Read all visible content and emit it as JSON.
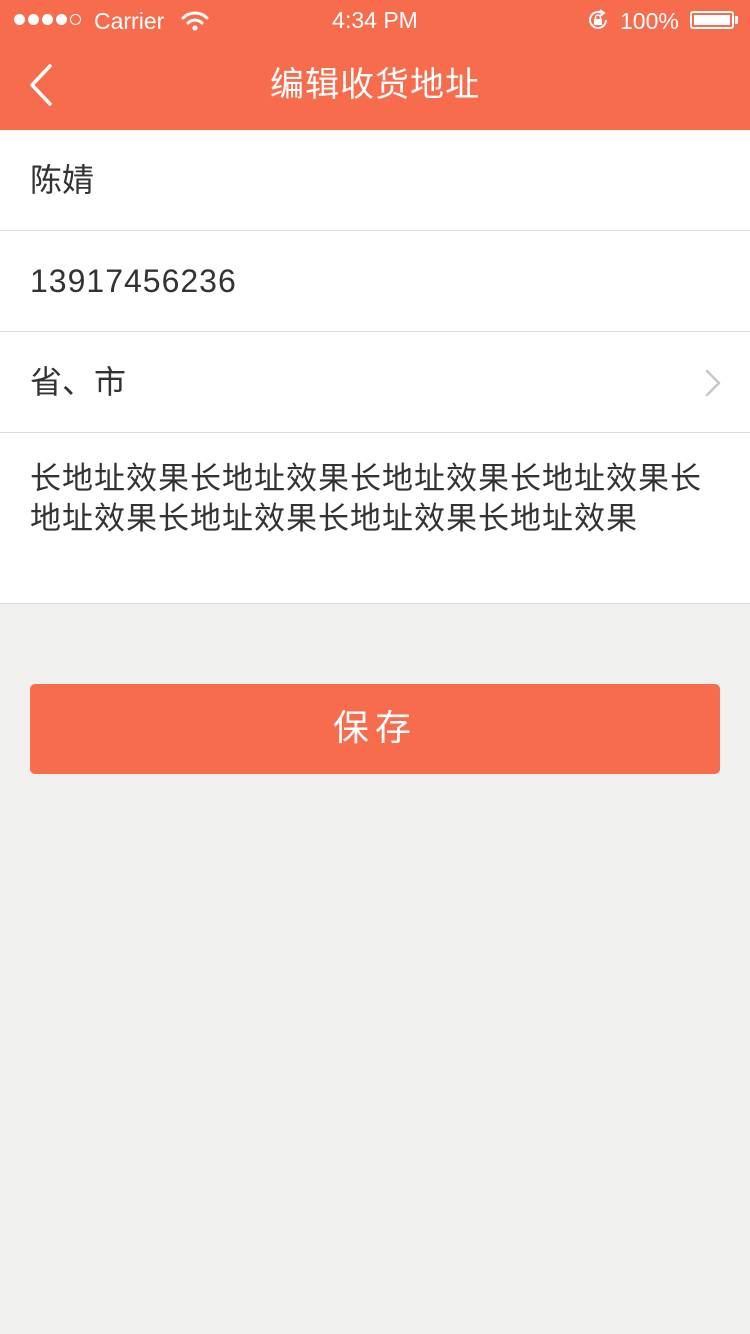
{
  "status_bar": {
    "carrier": "Carrier",
    "time": "4:34 PM",
    "battery": "100%",
    "battery_level": 1.0,
    "signal_bars": 4,
    "signal_total": 5
  },
  "nav": {
    "title": "编辑收货地址",
    "back_icon": "chevron-left-icon"
  },
  "form": {
    "name": "陈婧",
    "phone": "13917456236",
    "region": "省、市",
    "region_icon": "chevron-right-icon",
    "address": "长地址效果长地址效果长地址效果长地址效果长地址效果长地址效果长地址效果长地址效果"
  },
  "save_button": {
    "label": "保存"
  },
  "colors": {
    "accent": "#f76c4d",
    "background": "#f0f0ef",
    "text": "#333333",
    "divider": "#dcdcdc"
  }
}
